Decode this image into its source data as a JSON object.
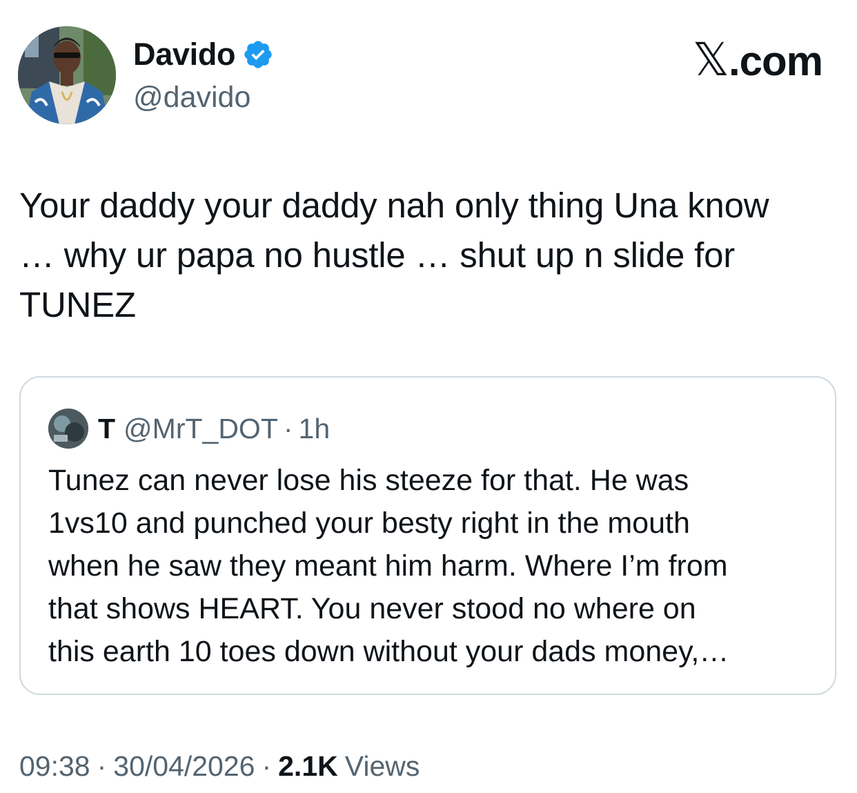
{
  "author": {
    "name": "Davido",
    "handle": "@davido",
    "verified_icon": "verified-badge-icon",
    "verified_color": "#1d9bf0"
  },
  "brand": {
    "x_glyph": "𝕏",
    "suffix": ".com"
  },
  "tweet": {
    "text": "Your daddy your daddy nah only thing Una know\n… why ur papa no hustle … shut up n slide for\nTUNEZ"
  },
  "quote": {
    "name": "T",
    "handle": "@MrT_DOT",
    "dot": "·",
    "time": "1h",
    "text": "Tunez can never lose his steeze for that. He was\n1vs10 and punched your besty right in the mouth\nwhen he saw they meant him harm. Where I’m from\nthat shows HEART. You never stood no where on\nthis earth 10 toes down without your dads money,…"
  },
  "meta": {
    "time": "09:38",
    "sep1": "·",
    "date": "30/04/2026",
    "sep2": "·",
    "views_count": "2.1K",
    "views_label": "Views"
  },
  "colors": {
    "text_primary": "#0f1419",
    "text_secondary": "#536471",
    "border": "#cfd9de",
    "verified_blue": "#1d9bf0"
  }
}
